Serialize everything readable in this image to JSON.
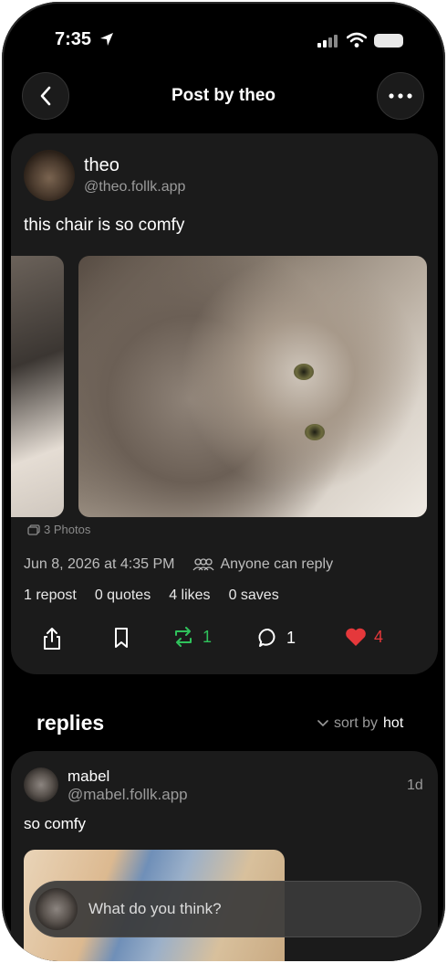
{
  "status": {
    "time": "7:35"
  },
  "nav": {
    "title": "Post by theo"
  },
  "post": {
    "author_name": "theo",
    "author_handle": "@theo.follk.app",
    "text": "this chair is so comfy",
    "photos_label": "3 Photos",
    "date": "Jun 8, 2026 at 4:35 PM",
    "reply_setting": "Anyone can reply",
    "stats": {
      "reposts": "1 repost",
      "quotes": "0 quotes",
      "likes": "4 likes",
      "saves": "0 saves"
    },
    "actions": {
      "repost_count": "1",
      "reply_count": "1",
      "like_count": "4"
    },
    "colors": {
      "repost": "#2fc25b",
      "like": "#e5383b"
    }
  },
  "replies": {
    "title": "replies",
    "sort_prefix": "sort by",
    "sort_value": "hot",
    "items": [
      {
        "author_name": "mabel",
        "author_handle": "@mabel.follk.app",
        "time": "1d",
        "text": "so comfy"
      }
    ]
  },
  "composer": {
    "placeholder": "What do you think?"
  }
}
